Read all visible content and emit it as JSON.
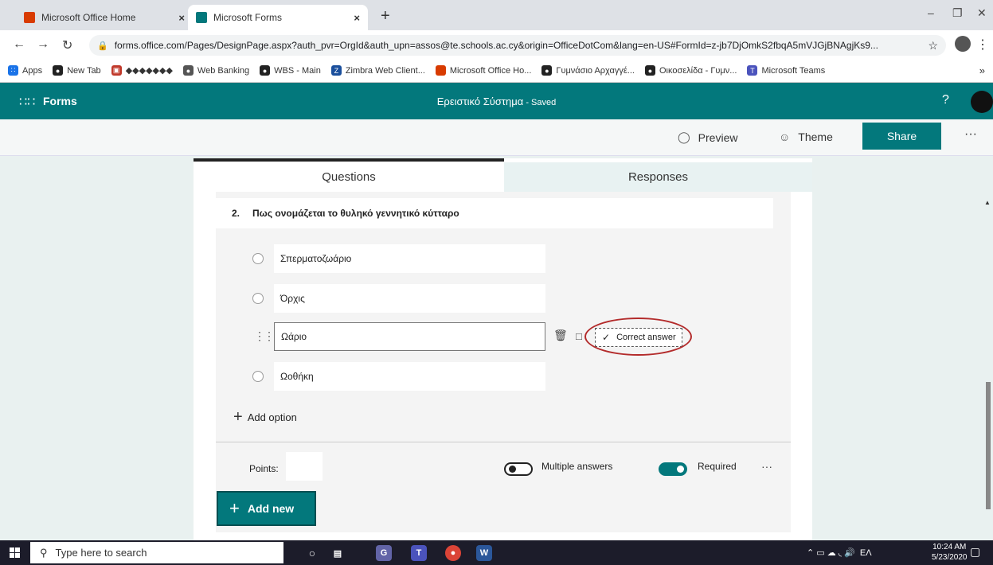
{
  "browser": {
    "tabs": [
      {
        "title": "Microsoft Office Home",
        "favicon_color": "#d83b01"
      },
      {
        "title": "Microsoft Forms",
        "favicon_color": "#03787c"
      }
    ],
    "tab_close": "×",
    "new_tab": "+",
    "url": "forms.office.com/Pages/DesignPage.aspx?auth_pvr=OrgId&auth_upn=assos@te.schools.ac.cy&origin=OfficeDotCom&lang=en-US#FormId=z-jb7DjOmkS2fbqA5mVJGjBNAgjKs9...",
    "bookmarks": [
      {
        "label": "Apps",
        "icon": "apps-grid-icon",
        "color": "#1a73e8"
      },
      {
        "label": "New Tab",
        "icon": "globe-icon",
        "color": "#222"
      },
      {
        "label": "◆◆◆◆◆◆◆",
        "icon": "bank-icon",
        "color": "#c0392b"
      },
      {
        "label": "Web Banking",
        "icon": "globe-icon",
        "color": "#555"
      },
      {
        "label": "WBS - Main",
        "icon": "globe-icon",
        "color": "#222"
      },
      {
        "label": "Zimbra Web Client...",
        "icon": "zimbra-icon",
        "color": "#1a4f9c"
      },
      {
        "label": "Microsoft Office Ho...",
        "icon": "office-icon",
        "color": "#d83b01"
      },
      {
        "label": "Γυμνάσιο Αρχαγγέ...",
        "icon": "globe-icon",
        "color": "#222"
      },
      {
        "label": "Οικοσελίδα - Γυμν...",
        "icon": "globe-icon",
        "color": "#222"
      },
      {
        "label": "Microsoft Teams",
        "icon": "teams-icon",
        "color": "#4b53bc"
      }
    ],
    "bookmarks_more": "»"
  },
  "forms_header": {
    "app_name": "Forms",
    "form_title": "Ερειστικό Σύστημα",
    "save_state": " - Saved",
    "help": "?"
  },
  "commands": {
    "preview": "Preview",
    "theme": "Theme",
    "share": "Share",
    "more": "···"
  },
  "tabs": {
    "questions": "Questions",
    "responses": "Responses"
  },
  "question": {
    "number": "2.",
    "text": "Πως ονομάζεται το θυληκό γεννητικό κύτταρο",
    "options": [
      "Σπερματοζωάριο",
      "Όρχις",
      "Ωάριο",
      "Ωοθήκη"
    ],
    "correct_answer_label": "Correct answer",
    "add_option": "Add option",
    "points_label": "Points:",
    "multiple_answers": "Multiple answers",
    "multiple_answers_on": false,
    "required": "Required",
    "required_on": true,
    "more": "···"
  },
  "add_new": "Add new",
  "taskbar": {
    "search_placeholder": "Type here to search",
    "language": "ΕΛ",
    "time": "10:24 AM",
    "date": "5/23/2020"
  }
}
